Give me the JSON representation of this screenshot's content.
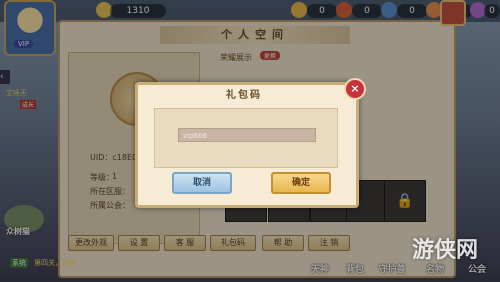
{
  "topbar": {
    "vip": "VIP",
    "gold": "1310",
    "stats": [
      "0",
      "0",
      "0",
      "0",
      "0"
    ]
  },
  "panel": {
    "title": "个人空间",
    "honor_label": "荣耀展示",
    "honor_button": "更换",
    "uid_label": "UID：c18E0",
    "level_label": "等级：",
    "level_value": "1",
    "region_label": "所在区服：",
    "guild_label": "所属公会："
  },
  "bottom_buttons": [
    "更改外观",
    "设 置",
    "客 服",
    "礼包码",
    "帮 助",
    "注 销"
  ],
  "bottom_nav": [
    "天神",
    "背包",
    "守护兽",
    "名物",
    "公会"
  ],
  "side": {
    "left_label": "立咏天",
    "new_tag": "成长",
    "char_name": "众树猫"
  },
  "dialog": {
    "title": "礼包码",
    "code_value": "vip666",
    "cancel_label": "取消",
    "confirm_label": "确定",
    "close_icon": "×"
  },
  "chat": {
    "tag": "系统",
    "text": "第四关，获得"
  },
  "watermark": "游侠网"
}
